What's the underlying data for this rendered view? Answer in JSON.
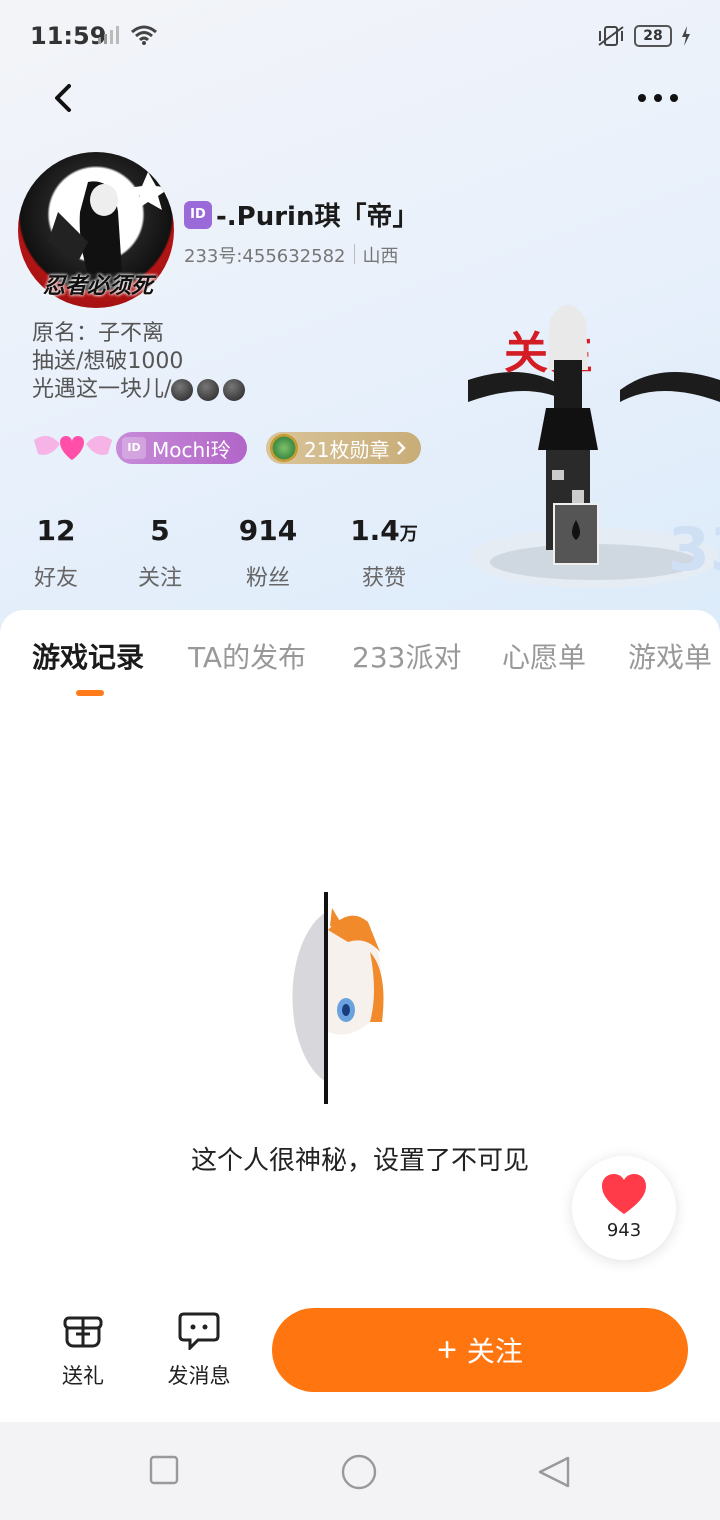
{
  "status": {
    "time": "11:59",
    "battery": "28"
  },
  "profile": {
    "avatar_text": "忍者必须死",
    "id_badge": "ID",
    "username": "-.Purin琪「帝」",
    "account_id": "233号:455632582",
    "location": "山西",
    "bio": [
      "原名：子不离",
      "抽送/想破1000",
      "光遇这一块儿/"
    ],
    "badge_name": "Mochi玲",
    "badge_id": "ID",
    "medals": "21枚勋章",
    "character_sign": "关注"
  },
  "stats": [
    {
      "value": "12",
      "unit": "",
      "label": "好友"
    },
    {
      "value": "5",
      "unit": "",
      "label": "关注"
    },
    {
      "value": "914",
      "unit": "",
      "label": "粉丝"
    },
    {
      "value": "1.4",
      "unit": "万",
      "label": "获赞"
    }
  ],
  "tabs": [
    "游戏记录",
    "TA的发布",
    "233派对",
    "心愿单",
    "游戏单"
  ],
  "active_tab": "游戏记录",
  "empty_state": {
    "message": "这个人很神秘，设置了不可见"
  },
  "like": {
    "count": "943"
  },
  "actions": {
    "gift": "送礼",
    "message": "发消息",
    "follow": "关注",
    "follow_icon": "+"
  },
  "colors": {
    "accent": "#ff7610",
    "badge_purple": "#b266c8",
    "medal_gold": "#c8ad78"
  }
}
